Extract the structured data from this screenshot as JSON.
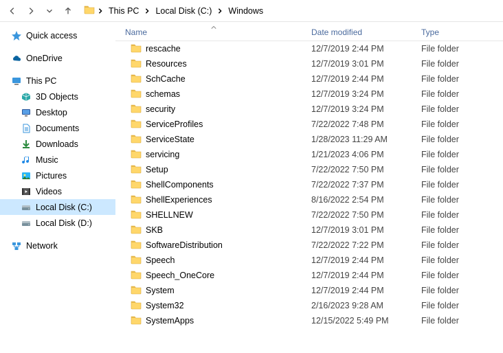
{
  "breadcrumb": {
    "items": [
      {
        "label": "This PC"
      },
      {
        "label": "Local Disk (C:)"
      },
      {
        "label": "Windows"
      }
    ]
  },
  "sidebar": {
    "quick_access": "Quick access",
    "onedrive": "OneDrive",
    "this_pc": "This PC",
    "children": [
      {
        "label": "3D Objects",
        "icon": "3d"
      },
      {
        "label": "Desktop",
        "icon": "desktop"
      },
      {
        "label": "Documents",
        "icon": "documents"
      },
      {
        "label": "Downloads",
        "icon": "downloads"
      },
      {
        "label": "Music",
        "icon": "music"
      },
      {
        "label": "Pictures",
        "icon": "pictures"
      },
      {
        "label": "Videos",
        "icon": "videos"
      },
      {
        "label": "Local Disk (C:)",
        "icon": "drive",
        "selected": true
      },
      {
        "label": "Local Disk (D:)",
        "icon": "drive"
      }
    ],
    "network": "Network"
  },
  "columns": {
    "name": "Name",
    "date": "Date modified",
    "type": "Type"
  },
  "rows": [
    {
      "name": "rescache",
      "date": "12/7/2019 2:44 PM",
      "type": "File folder"
    },
    {
      "name": "Resources",
      "date": "12/7/2019 3:01 PM",
      "type": "File folder"
    },
    {
      "name": "SchCache",
      "date": "12/7/2019 2:44 PM",
      "type": "File folder"
    },
    {
      "name": "schemas",
      "date": "12/7/2019 3:24 PM",
      "type": "File folder"
    },
    {
      "name": "security",
      "date": "12/7/2019 3:24 PM",
      "type": "File folder"
    },
    {
      "name": "ServiceProfiles",
      "date": "7/22/2022 7:48 PM",
      "type": "File folder"
    },
    {
      "name": "ServiceState",
      "date": "1/28/2023 11:29 AM",
      "type": "File folder"
    },
    {
      "name": "servicing",
      "date": "1/21/2023 4:06 PM",
      "type": "File folder"
    },
    {
      "name": "Setup",
      "date": "7/22/2022 7:50 PM",
      "type": "File folder"
    },
    {
      "name": "ShellComponents",
      "date": "7/22/2022 7:37 PM",
      "type": "File folder"
    },
    {
      "name": "ShellExperiences",
      "date": "8/16/2022 2:54 PM",
      "type": "File folder"
    },
    {
      "name": "SHELLNEW",
      "date": "7/22/2022 7:50 PM",
      "type": "File folder"
    },
    {
      "name": "SKB",
      "date": "12/7/2019 3:01 PM",
      "type": "File folder"
    },
    {
      "name": "SoftwareDistribution",
      "date": "7/22/2022 7:22 PM",
      "type": "File folder"
    },
    {
      "name": "Speech",
      "date": "12/7/2019 2:44 PM",
      "type": "File folder"
    },
    {
      "name": "Speech_OneCore",
      "date": "12/7/2019 2:44 PM",
      "type": "File folder"
    },
    {
      "name": "System",
      "date": "12/7/2019 2:44 PM",
      "type": "File folder"
    },
    {
      "name": "System32",
      "date": "2/16/2023 9:28 AM",
      "type": "File folder"
    },
    {
      "name": "SystemApps",
      "date": "12/15/2022 5:49 PM",
      "type": "File folder"
    }
  ]
}
